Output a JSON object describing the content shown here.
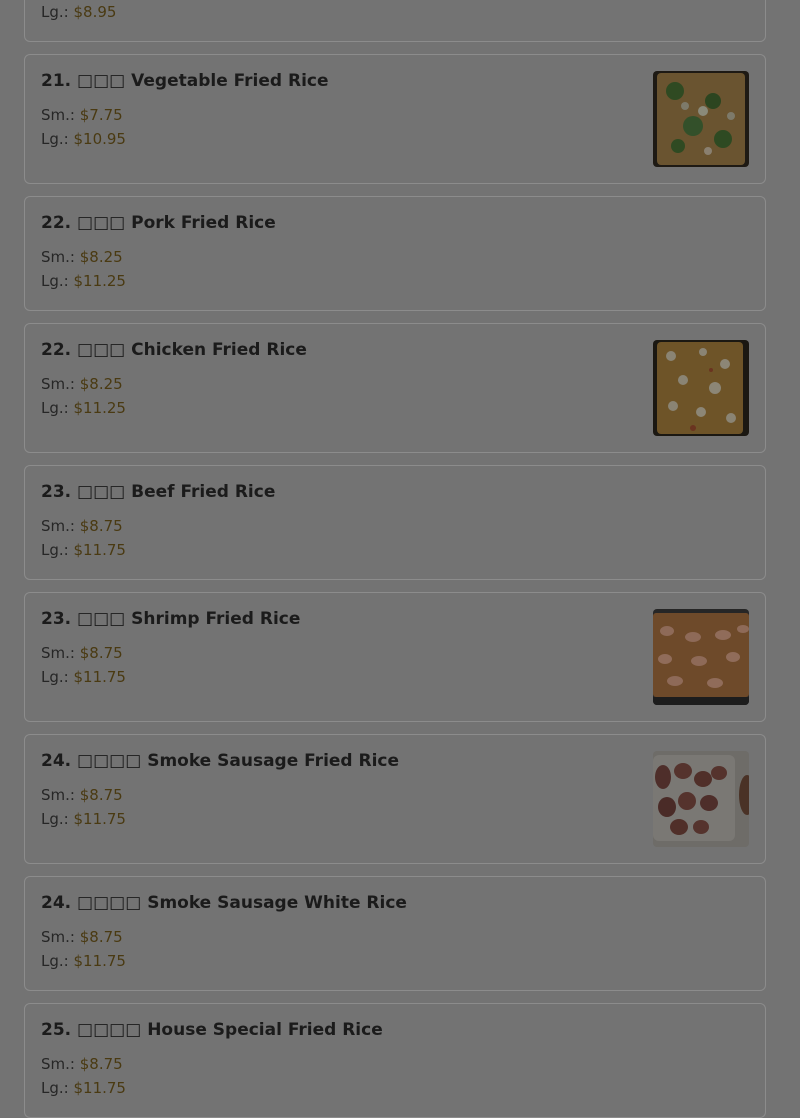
{
  "partial_top": {
    "lg_label": "Lg.:",
    "lg_price": "$8.95"
  },
  "items": [
    {
      "title": "21. □□□ Vegetable Fried Rice",
      "sm_label": "Sm.:",
      "sm_price": "$7.75",
      "lg_label": "Lg.:",
      "lg_price": "$10.95",
      "image": "vegetable-fried-rice-photo"
    },
    {
      "title": "22. □□□ Pork Fried Rice",
      "sm_label": "Sm.:",
      "sm_price": "$8.25",
      "lg_label": "Lg.:",
      "lg_price": "$11.25"
    },
    {
      "title": "22. □□□ Chicken Fried Rice",
      "sm_label": "Sm.:",
      "sm_price": "$8.25",
      "lg_label": "Lg.:",
      "lg_price": "$11.25",
      "image": "chicken-fried-rice-photo"
    },
    {
      "title": "23. □□□ Beef Fried Rice",
      "sm_label": "Sm.:",
      "sm_price": "$8.75",
      "lg_label": "Lg.:",
      "lg_price": "$11.75"
    },
    {
      "title": "23. □□□ Shrimp Fried Rice",
      "sm_label": "Sm.:",
      "sm_price": "$8.75",
      "lg_label": "Lg.:",
      "lg_price": "$11.75",
      "image": "shrimp-fried-rice-photo"
    },
    {
      "title": "24. □□□□ Smoke Sausage Fried Rice",
      "sm_label": "Sm.:",
      "sm_price": "$8.75",
      "lg_label": "Lg.:",
      "lg_price": "$11.75",
      "image": "smoke-sausage-photo"
    },
    {
      "title": "24. □□□□ Smoke Sausage White Rice",
      "sm_label": "Sm.:",
      "sm_price": "$8.75",
      "lg_label": "Lg.:",
      "lg_price": "$11.75"
    },
    {
      "title": "25. □□□□ House Special Fried Rice",
      "sm_label": "Sm.:",
      "sm_price": "$8.75",
      "lg_label": "Lg.:",
      "lg_price": "$11.75"
    }
  ],
  "colors": {
    "overlay": "#737373",
    "border": "#8c8c8c",
    "title": "#1b1b1b",
    "price": "#4a3a12"
  }
}
